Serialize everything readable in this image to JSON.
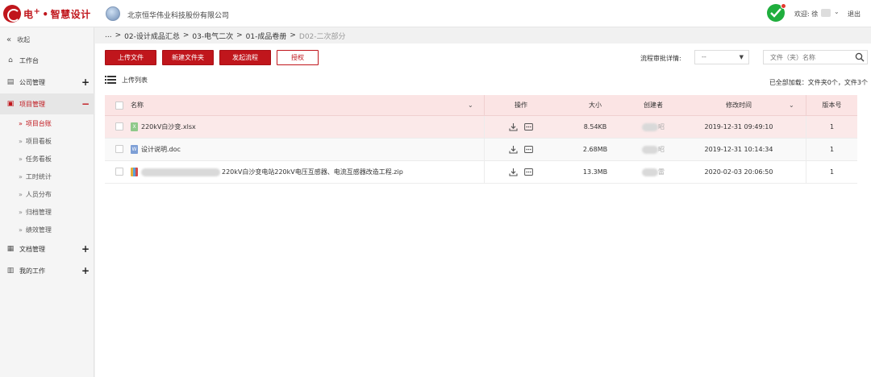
{
  "header": {
    "logo_main": "电",
    "logo_sup": "+",
    "logo_dot": "•",
    "logo_sub": "智慧设计",
    "company": "北京恒华伟业科技股份有限公司",
    "welcome": "欢迎: 徐",
    "logout": "退出",
    "accent": "#c0161c"
  },
  "sidebar": {
    "collapse": "收起",
    "items": [
      {
        "label": "工作台",
        "icon": "home-icon"
      },
      {
        "label": "公司管理",
        "icon": "company-icon",
        "toggle": "+"
      },
      {
        "label": "项目管理",
        "icon": "project-icon",
        "toggle": "−",
        "active": true
      },
      {
        "label": "文档管理",
        "icon": "document-icon",
        "toggle": "+"
      },
      {
        "label": "我的工作",
        "icon": "work-icon",
        "toggle": "+"
      }
    ],
    "subitems": [
      "项目台账",
      "项目看板",
      "任务看板",
      "工时统计",
      "人员分布",
      "归档管理",
      "绩效管理"
    ]
  },
  "breadcrumb": {
    "root": "...",
    "items": [
      "02-设计成品汇总",
      "03-电气二次",
      "01-成品卷册"
    ],
    "current": "D02-二次部分",
    "sep": ">"
  },
  "toolbar": {
    "upload": "上传文件",
    "new_folder": "新建文件夹",
    "start_flow": "发起流程",
    "authorize": "授权",
    "flow_label": "流程审批详情:",
    "flow_value": "--",
    "search_placeholder": "文件（夹）名称"
  },
  "list": {
    "title": "上传列表",
    "loaded": "已全部加载：文件夹0个，文件3个"
  },
  "table": {
    "headers": {
      "name": "名称",
      "ops": "操作",
      "size": "大小",
      "creator": "创建者",
      "modified": "修改时间",
      "version": "版本号"
    },
    "rows": [
      {
        "name": "220kV白沙变.xlsx",
        "type": "xls",
        "size": "8.54KB",
        "creator_tail": "昭",
        "modified": "2019-12-31 09:49:10",
        "version": "1"
      },
      {
        "name": "设计说明.doc",
        "type": "doc",
        "size": "2.68MB",
        "creator_tail": "昭",
        "modified": "2019-12-31 10:14:34",
        "version": "1"
      },
      {
        "name": "220kV白沙变电站220kV电压互感器、电流互感器改造工程.zip",
        "type": "zip",
        "size": "13.3MB",
        "creator_tail": "雷",
        "modified": "2020-02-03 20:06:50",
        "version": "1"
      }
    ]
  }
}
